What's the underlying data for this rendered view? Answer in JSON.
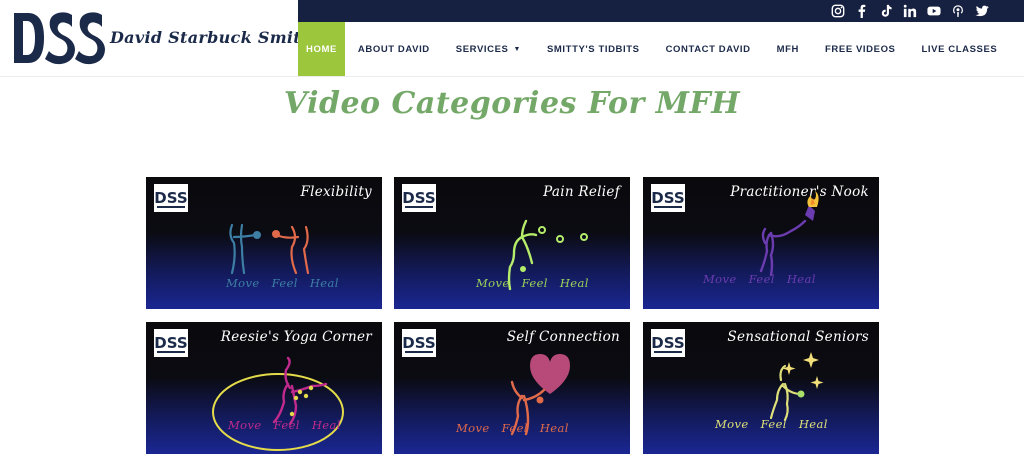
{
  "brand": {
    "name": "David Starbuck Smith",
    "logo_letters": "DSS"
  },
  "social_icons": [
    "instagram-icon",
    "facebook-icon",
    "tiktok-icon",
    "linkedin-icon",
    "youtube-icon",
    "podcast-icon",
    "twitter-icon"
  ],
  "nav": {
    "items": [
      {
        "label": "HOME",
        "active": true
      },
      {
        "label": "ABOUT DAVID"
      },
      {
        "label": "SERVICES",
        "dropdown": true
      },
      {
        "label": "SMITTY'S TIDBITS"
      },
      {
        "label": "CONTACT DAVID"
      },
      {
        "label": "MFH"
      },
      {
        "label": "FREE VIDEOS"
      },
      {
        "label": "LIVE CLASSES"
      }
    ]
  },
  "page": {
    "title": "Video Categories For MFH"
  },
  "cards": [
    {
      "title": "Flexibility",
      "tagline": [
        "Move",
        "Feel",
        "Heal"
      ],
      "tagline_color": "#3d7fa4"
    },
    {
      "title": "Pain Relief",
      "tagline": [
        "Move",
        "Feel",
        "Heal"
      ],
      "tagline_color": "#9bd25a"
    },
    {
      "title": "Practitioner's Nook",
      "tagline": [
        "Move",
        "Feel",
        "Heal"
      ],
      "tagline_color": "#6a3cb0"
    },
    {
      "title": "Reesie's Yoga Corner",
      "tagline": [
        "Move",
        "Feel",
        "Heal"
      ],
      "tagline_color": "#c02a8c"
    },
    {
      "title": "Self Connection",
      "tagline": [
        "Move",
        "Feel",
        "Heal"
      ],
      "tagline_color": "#e06a4a"
    },
    {
      "title": "Sensational Seniors",
      "tagline": [
        "Move",
        "Feel",
        "Heal"
      ],
      "tagline_color": "#dfe07a"
    }
  ],
  "colors": {
    "accent": "#9cc63b",
    "navy": "#162040",
    "title_green": "#74a868"
  }
}
